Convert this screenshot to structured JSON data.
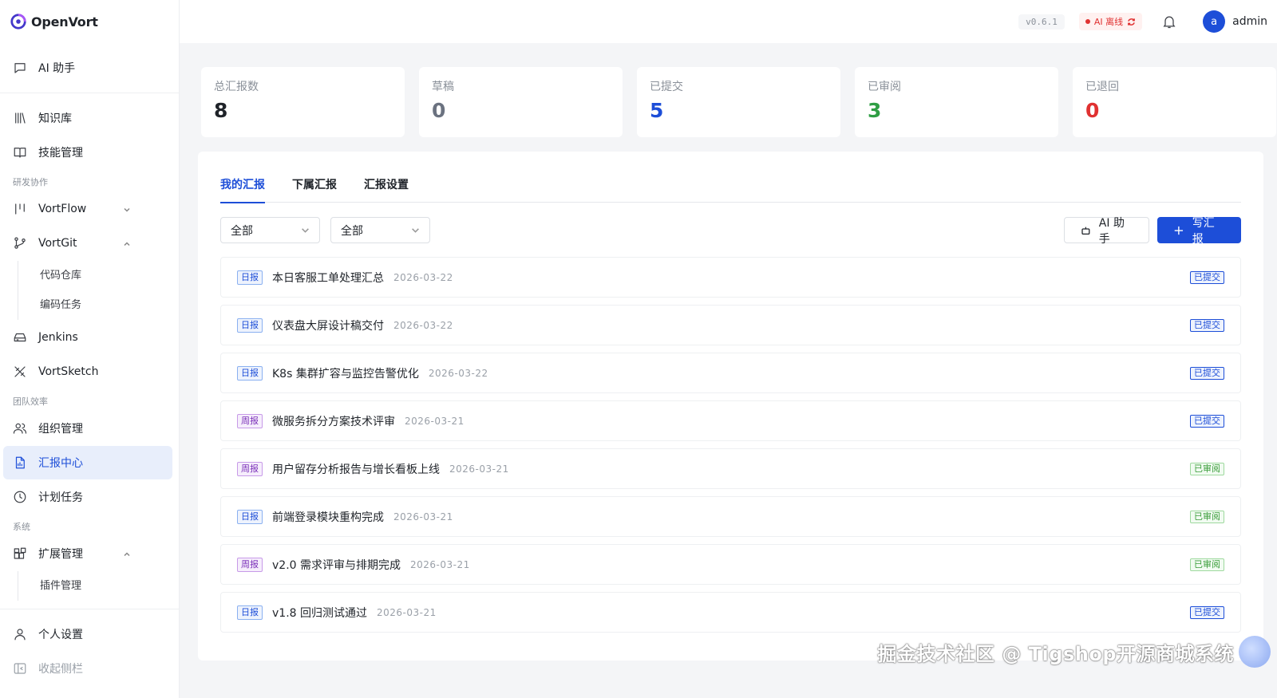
{
  "brand": {
    "name": "OpenVort"
  },
  "header": {
    "version": "v0.6.1",
    "ai_status": "AI 离线",
    "avatar_letter": "a",
    "username": "admin"
  },
  "sidebar": {
    "ai_assistant": "AI 助手",
    "knowledge": "知识库",
    "skills": "技能管理",
    "section_rd": "研发协作",
    "vortflow": "VortFlow",
    "vortgit": "VortGit",
    "vortgit_sub": [
      "代码仓库",
      "编码任务"
    ],
    "jenkins": "Jenkins",
    "vortsketch": "VortSketch",
    "section_team": "团队效率",
    "org": "组织管理",
    "report_center": "汇报中心",
    "plans": "计划任务",
    "section_system": "系统",
    "extensions": "扩展管理",
    "extensions_sub": [
      "插件管理"
    ],
    "personal": "个人设置",
    "collapse": "收起侧栏"
  },
  "stats": [
    {
      "label": "总汇报数",
      "value": "8",
      "color": "#1f2329"
    },
    {
      "label": "草稿",
      "value": "0",
      "color": "#6b7280"
    },
    {
      "label": "已提交",
      "value": "5",
      "color": "#1d4ed8"
    },
    {
      "label": "已审阅",
      "value": "3",
      "color": "#2f9e44"
    },
    {
      "label": "已退回",
      "value": "0",
      "color": "#e03131"
    }
  ],
  "tabs": [
    "我的汇报",
    "下属汇报",
    "汇报设置"
  ],
  "filters": {
    "type": "全部",
    "status": "全部"
  },
  "actions": {
    "ai": "AI 助手",
    "write": "写汇报"
  },
  "reports": [
    {
      "type": "日报",
      "kind": "day",
      "title": "本日客服工单处理汇总",
      "date": "2026-03-22",
      "status": "已提交",
      "status_kind": "submitted"
    },
    {
      "type": "日报",
      "kind": "day",
      "title": "仪表盘大屏设计稿交付",
      "date": "2026-03-22",
      "status": "已提交",
      "status_kind": "submitted"
    },
    {
      "type": "日报",
      "kind": "day",
      "title": "K8s 集群扩容与监控告警优化",
      "date": "2026-03-22",
      "status": "已提交",
      "status_kind": "submitted"
    },
    {
      "type": "周报",
      "kind": "week",
      "title": "微服务拆分方案技术评审",
      "date": "2026-03-21",
      "status": "已提交",
      "status_kind": "submitted"
    },
    {
      "type": "周报",
      "kind": "week",
      "title": "用户留存分析报告与增长看板上线",
      "date": "2026-03-21",
      "status": "已审阅",
      "status_kind": "reviewed"
    },
    {
      "type": "日报",
      "kind": "day",
      "title": "前端登录模块重构完成",
      "date": "2026-03-21",
      "status": "已审阅",
      "status_kind": "reviewed"
    },
    {
      "type": "周报",
      "kind": "week",
      "title": "v2.0 需求评审与排期完成",
      "date": "2026-03-21",
      "status": "已审阅",
      "status_kind": "reviewed"
    },
    {
      "type": "日报",
      "kind": "day",
      "title": "v1.8 回归测试通过",
      "date": "2026-03-21",
      "status": "已提交",
      "status_kind": "submitted"
    }
  ],
  "watermark": "掘金技术社区 @ Tigshop开源商城系统"
}
